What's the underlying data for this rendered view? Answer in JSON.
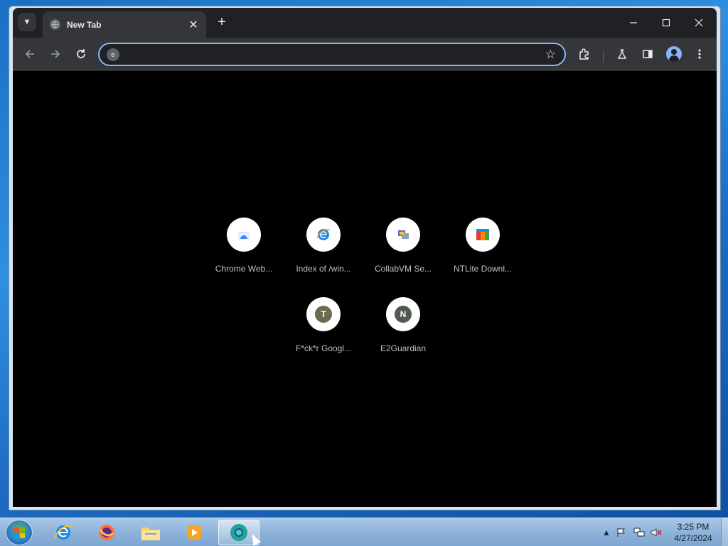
{
  "browser": {
    "tab": {
      "title": "New Tab"
    },
    "omnibox": {
      "value": "",
      "placeholder": ""
    }
  },
  "shortcuts": [
    {
      "label": "Chrome Web...",
      "icon": "chrome-web-store-icon"
    },
    {
      "label": "Index of /win...",
      "icon": "internet-explorer-icon"
    },
    {
      "label": "CollabVM Se...",
      "icon": "collabvm-icon"
    },
    {
      "label": "NTLite Downl...",
      "icon": "ntlite-icon"
    },
    {
      "label": "F*ck*r Googl...",
      "letter": "T",
      "color": "#6b6b4f"
    },
    {
      "label": "E2Guardian",
      "letter": "N",
      "color": "#4f5a50"
    }
  ],
  "taskbar": {
    "apps": [
      "internet-explorer-icon",
      "firefox-icon",
      "file-explorer-icon",
      "media-player-icon",
      "chromium-icon"
    ],
    "clock": {
      "time": "3:25 PM",
      "date": "4/27/2024"
    }
  },
  "colors": {
    "accent": "#8ab4f8",
    "toolbar": "#35363a",
    "tabstrip": "#202124",
    "content": "#000000"
  }
}
